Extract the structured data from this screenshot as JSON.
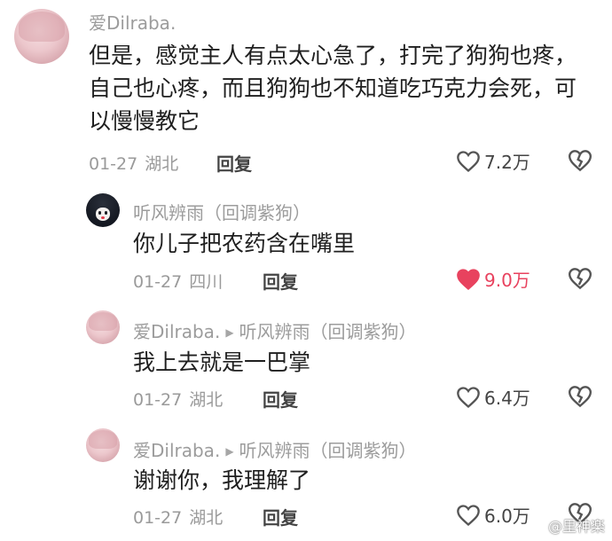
{
  "comments": [
    {
      "username": "爱Dilraba.",
      "text": "但是，感觉主人有点太心急了，打完了狗狗也疼，自己也心疼，而且狗狗也不知道吃巧克力会死，可以慢慢教它",
      "date": "01-27",
      "location": "湖北",
      "reply": "回复",
      "likes": "7.2万",
      "liked": false
    },
    {
      "username": "听风辨雨（回调紫狗）",
      "text": "你儿子把农药含在嘴里",
      "date": "01-27",
      "location": "四川",
      "reply": "回复",
      "likes": "9.0万",
      "liked": true
    },
    {
      "username": "爱Dilraba.",
      "reply_to": "听风辨雨（回调紫狗）",
      "text": "我上去就是一巴掌",
      "date": "01-27",
      "location": "湖北",
      "reply": "回复",
      "likes": "6.4万",
      "liked": false
    },
    {
      "username": "爱Dilraba.",
      "reply_to": "听风辨雨（回调紫狗）",
      "text": "谢谢你，我理解了",
      "date": "01-27",
      "location": "湖北",
      "reply": "回复",
      "likes": "6.0万",
      "liked": false
    }
  ],
  "watermark": "@里神楽",
  "colors": {
    "like_active": "#e8425e",
    "meta": "#9a9a9a",
    "text": "#1f1f1f"
  }
}
